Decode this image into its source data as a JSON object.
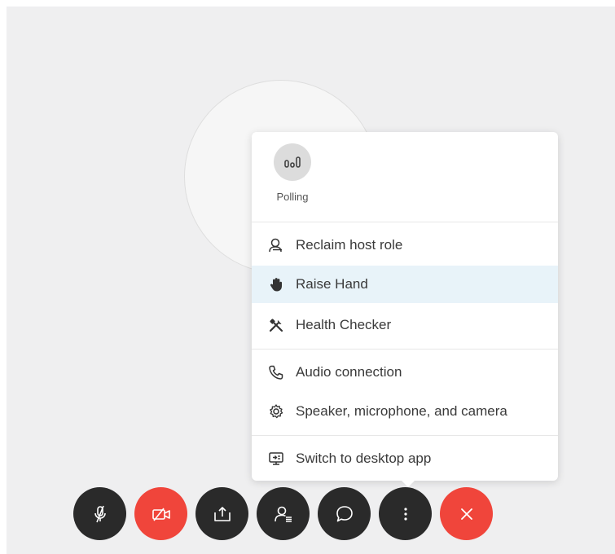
{
  "menu": {
    "polling_label": "Polling",
    "items": [
      {
        "label": "Reclaim host role",
        "icon": "person-key-icon"
      },
      {
        "label": "Raise Hand",
        "icon": "hand-icon"
      },
      {
        "label": "Health Checker",
        "icon": "tools-icon"
      },
      {
        "label": "Audio connection",
        "icon": "phone-icon"
      },
      {
        "label": "Speaker, microphone, and camera",
        "icon": "gear-icon"
      },
      {
        "label": "Switch to desktop app",
        "icon": "desktop-app-icon"
      }
    ],
    "highlighted_item": "Raise Hand",
    "highlight_color": "#e8f3f9"
  },
  "toolbar": {
    "buttons": [
      {
        "name": "mute",
        "icon": "microphone-muted-icon",
        "color": "#2a2a2a"
      },
      {
        "name": "video",
        "icon": "video-off-icon",
        "color": "#f0453b"
      },
      {
        "name": "share",
        "icon": "share-icon",
        "color": "#2a2a2a"
      },
      {
        "name": "participants",
        "icon": "participants-icon",
        "color": "#2a2a2a"
      },
      {
        "name": "chat",
        "icon": "chat-icon",
        "color": "#2a2a2a"
      },
      {
        "name": "more",
        "icon": "more-options-icon",
        "color": "#2a2a2a"
      },
      {
        "name": "leave",
        "icon": "close-icon",
        "color": "#f0453b"
      }
    ]
  },
  "colors": {
    "background": "#efeff0",
    "danger": "#f0453b",
    "control_dark": "#2a2a2a"
  }
}
